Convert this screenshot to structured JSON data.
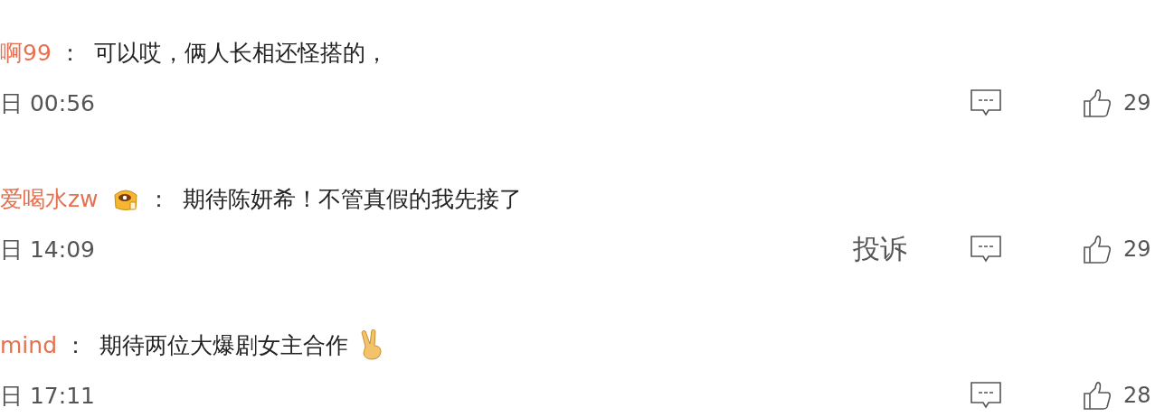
{
  "comments": [
    {
      "username": "啊99",
      "badge": false,
      "separator": "：",
      "text": "可以哎，俩人长相还怪搭的，",
      "emoji": false,
      "date": "日 00:56",
      "like_count": "29"
    },
    {
      "username": "爱喝水zw",
      "badge": true,
      "separator": "：",
      "text": "期待陈妍希！不管真假的我先接了",
      "emoji": false,
      "date": "日 14:09",
      "report": "投诉",
      "like_count": "29"
    },
    {
      "username": "mind",
      "badge": false,
      "separator": "：",
      "text": "期待两位大爆剧女主合作",
      "emoji": true,
      "date": "日 17:11",
      "like_count": "28"
    }
  ]
}
